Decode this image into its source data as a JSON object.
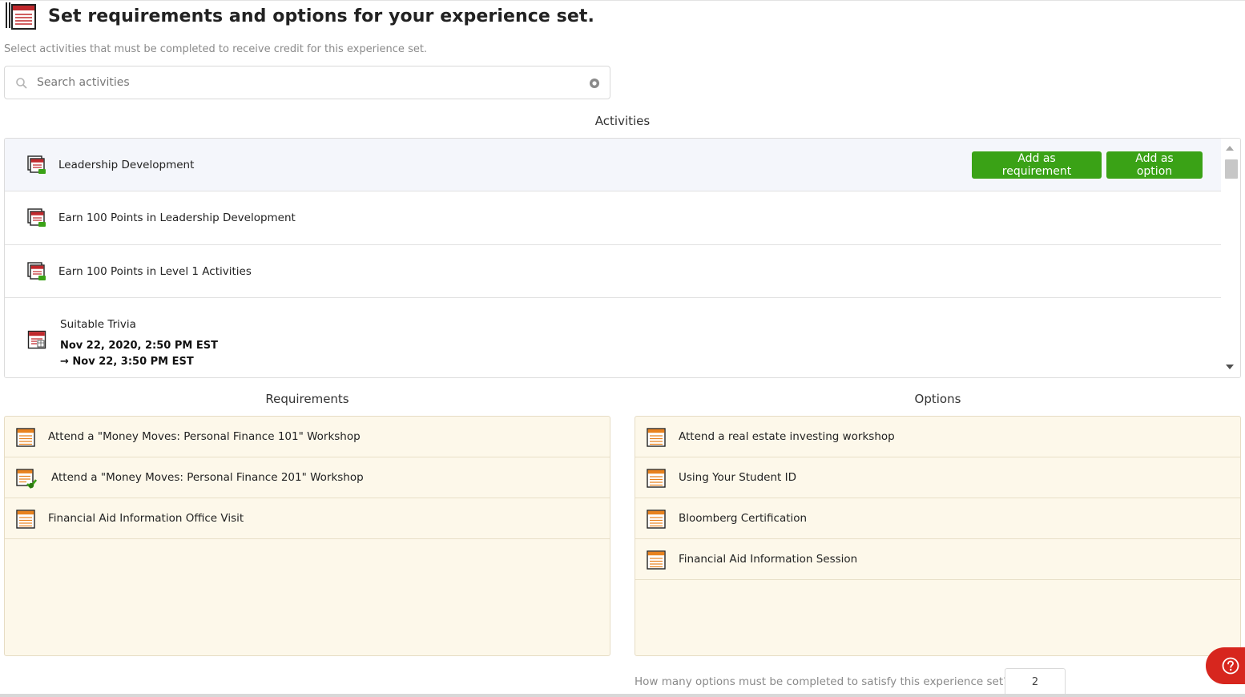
{
  "page": {
    "title": "Set requirements and options for your experience set.",
    "subtitle": "Select activities that must be completed to receive credit for this experience set."
  },
  "search": {
    "placeholder": "Search activities",
    "value": ""
  },
  "activities": {
    "heading": "Activities",
    "items": [
      {
        "label": "Leadership Development",
        "icon": "track-stack-icon"
      },
      {
        "label": "Earn 100 Points in Leadership Development",
        "icon": "track-stack-icon"
      },
      {
        "label": "Earn 100 Points in Level 1 Activities",
        "icon": "track-stack-icon"
      },
      {
        "label": "Suitable Trivia",
        "icon": "event-calendar-icon",
        "date_start": "Nov 22, 2020, 2:50 PM EST",
        "date_end": "→ Nov 22, 3:50 PM EST"
      }
    ],
    "add_requirement_label": "Add as requirement",
    "add_option_label": "Add as option"
  },
  "requirements": {
    "heading": "Requirements",
    "items": [
      {
        "label": "Attend a \"Money Moves: Personal Finance 101\" Workshop",
        "icon": "event-list-icon"
      },
      {
        "label": "Attend a \"Money Moves: Personal Finance 201\" Workshop",
        "icon": "event-checkin-icon"
      },
      {
        "label": "Financial Aid Information Office Visit",
        "icon": "event-list-icon"
      }
    ]
  },
  "options": {
    "heading": "Options",
    "items": [
      {
        "label": "Attend a real estate investing workshop",
        "icon": "event-list-icon"
      },
      {
        "label": "Using Your Student ID",
        "icon": "event-list-icon"
      },
      {
        "label": "Bloomberg Certification",
        "icon": "event-list-icon"
      },
      {
        "label": "Financial Aid Information Session",
        "icon": "event-list-icon"
      }
    ],
    "count_question": "How many options must be completed to satisfy this experience set?",
    "count_value": "2"
  },
  "colors": {
    "button_green": "#3aa216",
    "list_background": "#fdf8ea",
    "help_red": "#d7261e",
    "icon_orange": "#e8821e",
    "icon_red": "#c0282c"
  }
}
